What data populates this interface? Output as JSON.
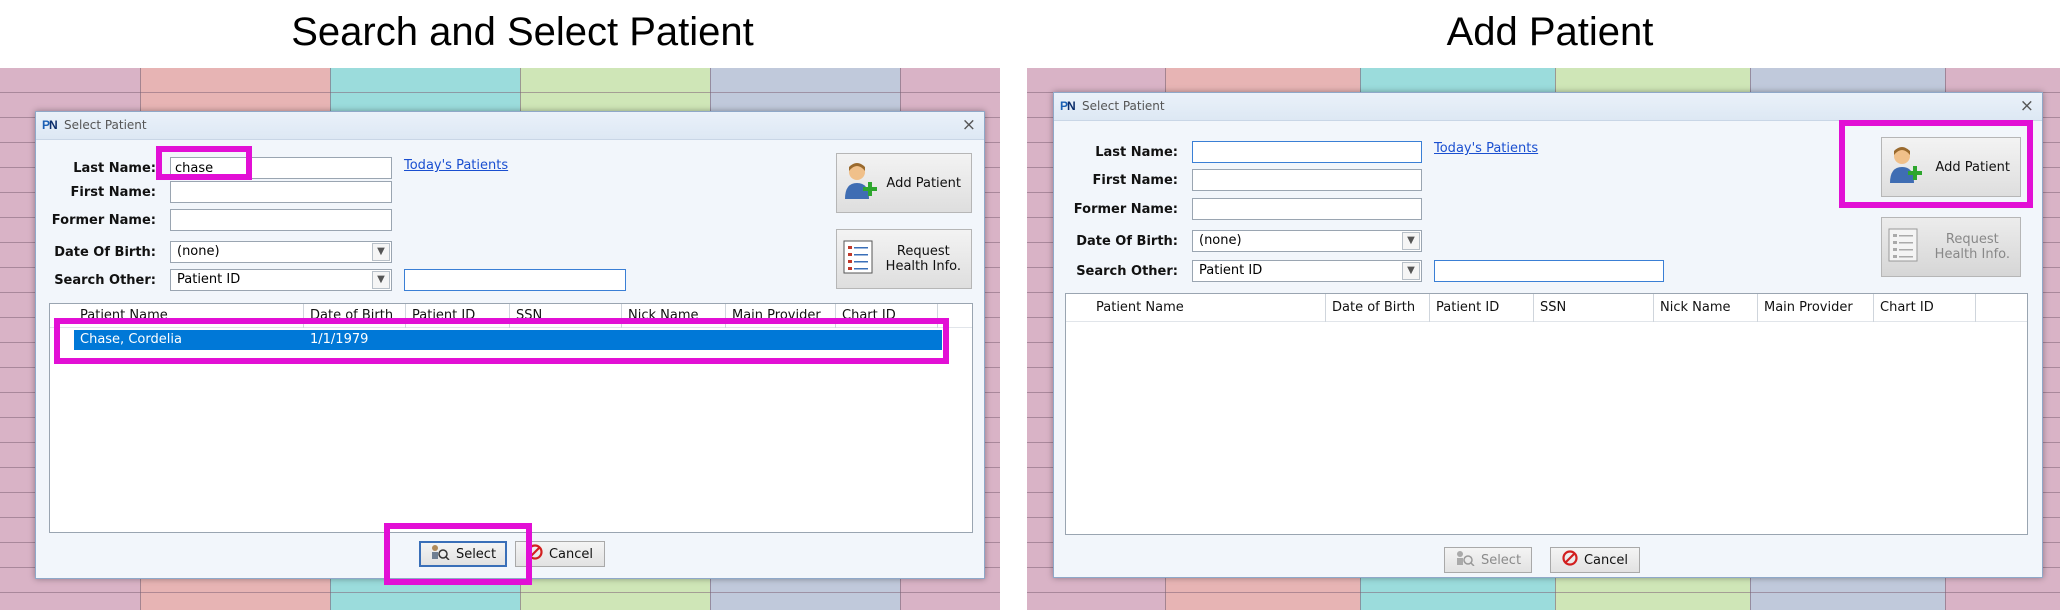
{
  "headings": {
    "left": "Search and Select Patient",
    "right": "Add Patient"
  },
  "colors": {
    "highlight": "#e20fd5",
    "selection": "#0078d7",
    "link": "#1a4fd0"
  },
  "dialog": {
    "logo_p": "P",
    "logo_n": "N",
    "title": "Select Patient",
    "close": "×",
    "labels": {
      "last_name": "Last Name:",
      "first_name": "First Name:",
      "former_name": "Former Name:",
      "dob": "Date Of Birth:",
      "search_other": "Search Other:"
    },
    "todays_patients": "Today's Patients",
    "dob_value": "(none)",
    "search_other_value": "Patient ID",
    "add_patient": "Add Patient",
    "request_health_line1": "Request",
    "request_health_line2": "Health Info.",
    "columns": [
      "Patient Name",
      "Date of Birth",
      "Patient ID",
      "SSN",
      "Nick Name",
      "Main Provider",
      "Chart ID"
    ],
    "select": "Select",
    "cancel": "Cancel"
  },
  "left_panel": {
    "last_name_value": "chase",
    "first_name_value": "",
    "former_name_value": "",
    "search_other_text": "",
    "rows": [
      {
        "patient_name": "Chase, Cordelia",
        "dob": "1/1/1979"
      }
    ],
    "add_patient_enabled": true,
    "request_health_enabled": true,
    "select_enabled": true
  },
  "right_panel": {
    "last_name_value": "",
    "first_name_value": "",
    "former_name_value": "",
    "search_other_text": "",
    "rows": [],
    "add_patient_enabled": true,
    "request_health_enabled": false,
    "select_enabled": false
  }
}
